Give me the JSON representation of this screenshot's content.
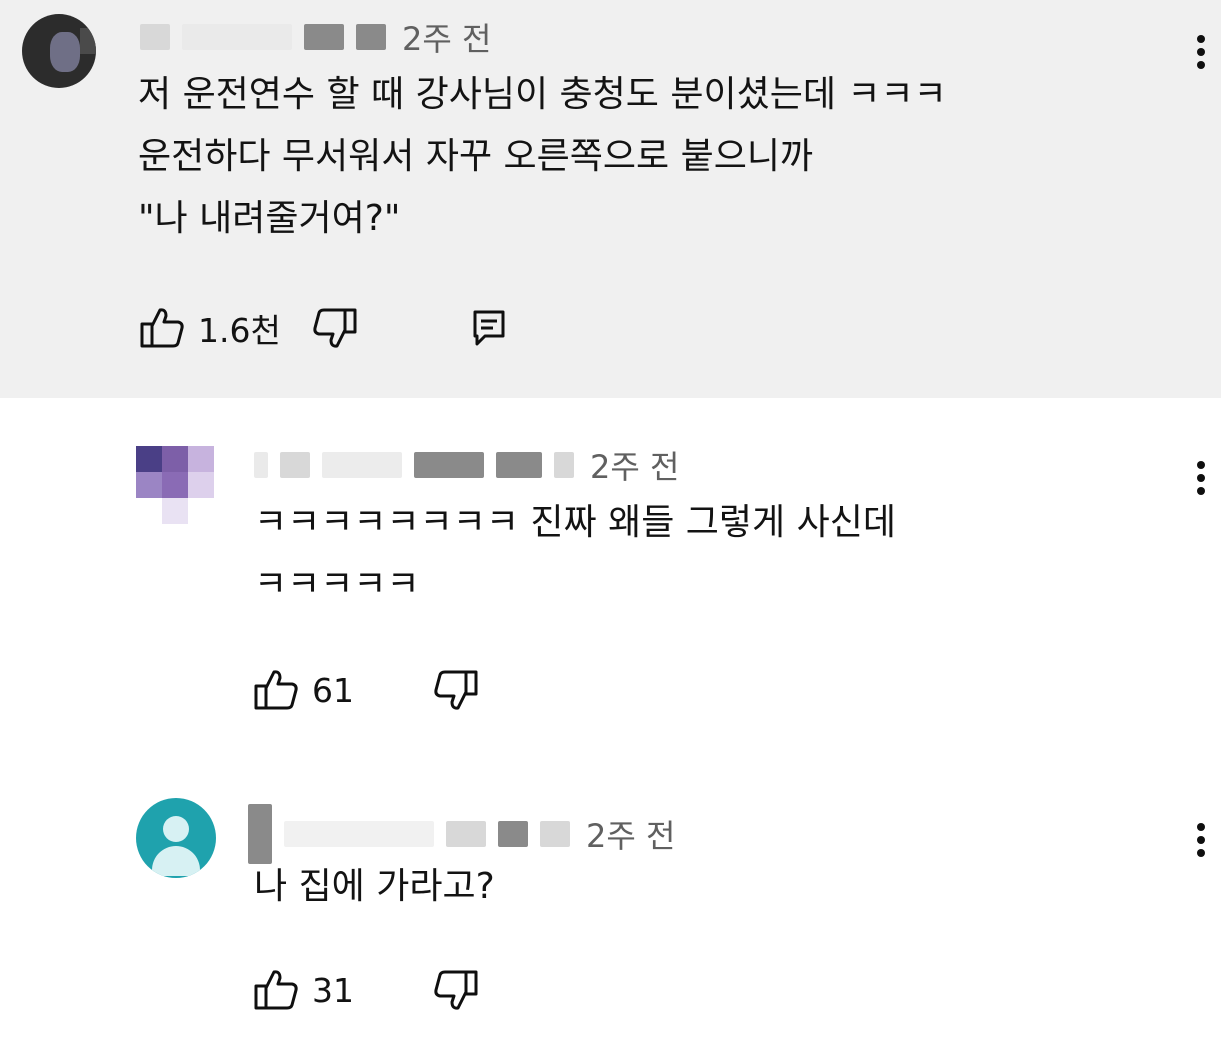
{
  "comments": [
    {
      "time": "2주 전",
      "text": "저 운전연수 할 때 강사님이 충청도 분이셨는데 ㅋㅋㅋ\n운전하다 무서워서 자꾸 오른쪽으로 붙으니까\n\"나 내려줄거여?\"",
      "likes": "1.6천"
    },
    {
      "time": "2주 전",
      "text": "ㅋㅋㅋㅋㅋㅋㅋㅋ 진짜 왜들 그렇게 사신데\nㅋㅋㅋㅋㅋ",
      "likes": "61"
    },
    {
      "time": "2주 전",
      "text": "나 집에 가라고?",
      "likes": "31"
    }
  ],
  "colors": {
    "highlight_bg": "#f0f0f0",
    "avatar_teal": "#1fa2ad",
    "avatar_purple": "#7d5fa8"
  }
}
